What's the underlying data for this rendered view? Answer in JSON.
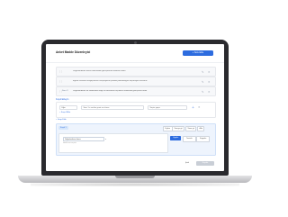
{
  "app": {
    "title": "Anket Madde Düzenleyici",
    "add_button": "+ Soru Ekle"
  },
  "question_rows": [
    {
      "num": "",
      "text": "Değerlendirme formu hakkındaki görüşlerinizi belirtiniz lütfen"
    },
    {
      "num": "",
      "text": "Eğitim süresinin ihtiyaçlarınızı karşılayacak şekilde planlandığını düşünüyor musunuz"
    },
    {
      "num": "Soru 3",
      "text": "Değerlendirme ile hedeflenen bilgi ve becerilerin ölçülmesi hakkında görüşünüz nedir"
    }
  ],
  "logic_section": {
    "label": "Koşul Ekleyin",
    "type_field": "Eğer",
    "question_field": "Soru 1 e verilen yanıt ne olursa",
    "condition_field": "Seçim yapın",
    "add_link": "+ Koşul Ekle"
  },
  "add_group_link": "+ Grup Ekle",
  "rule_panel": {
    "chip": "Koşul 1",
    "tabs": [
      "Eylem",
      "Soruya git",
      "Sona git",
      "Atla"
    ],
    "select_value": "Değerlendirme formu",
    "hint": "Hedef soru seçiniz",
    "buttons": {
      "apply": "Uygula",
      "clear": "Temizle",
      "duplicate": "Kopyala"
    }
  },
  "footer": {
    "cancel": "İptal",
    "save": "Kaydet"
  },
  "colors": {
    "accent": "#2d6cdf",
    "device": "#2a2a2e"
  }
}
